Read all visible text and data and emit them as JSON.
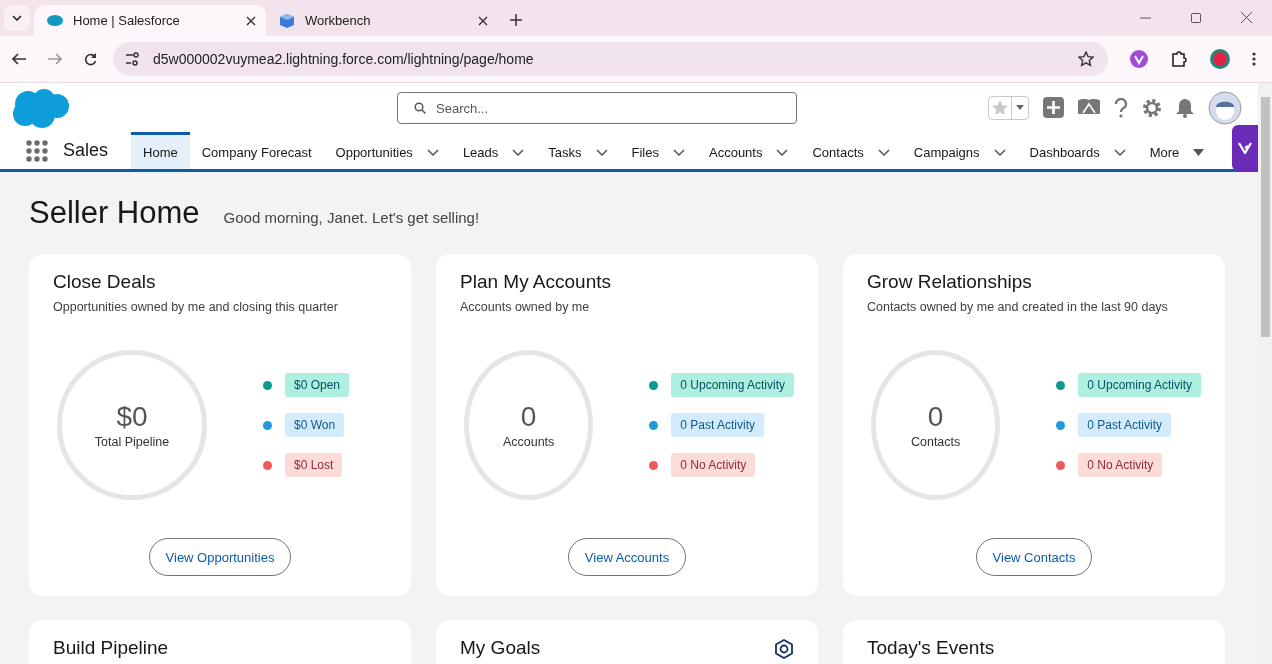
{
  "browser": {
    "tabs": [
      {
        "title": "Home | Salesforce",
        "selected": true
      },
      {
        "title": "Workbench",
        "selected": false
      }
    ],
    "url": "d5w000002vuymea2.lightning.force.com/lightning/page/home"
  },
  "header": {
    "search": {
      "placeholder": "Search..."
    }
  },
  "app": {
    "name": "Sales",
    "nav": [
      {
        "label": "Home",
        "selected": true,
        "kind": "plain"
      },
      {
        "label": "Company Forecast",
        "selected": false,
        "kind": "plain"
      },
      {
        "label": "Opportunities",
        "selected": false,
        "kind": "dropdown"
      },
      {
        "label": "Leads",
        "selected": false,
        "kind": "dropdown"
      },
      {
        "label": "Tasks",
        "selected": false,
        "kind": "dropdown"
      },
      {
        "label": "Files",
        "selected": false,
        "kind": "dropdown"
      },
      {
        "label": "Accounts",
        "selected": false,
        "kind": "dropdown"
      },
      {
        "label": "Contacts",
        "selected": false,
        "kind": "dropdown"
      },
      {
        "label": "Campaigns",
        "selected": false,
        "kind": "dropdown"
      },
      {
        "label": "Dashboards",
        "selected": false,
        "kind": "dropdown"
      },
      {
        "label": "More",
        "selected": false,
        "kind": "more"
      }
    ]
  },
  "page": {
    "title": "Seller Home",
    "greeting": "Good morning, Janet. Let's get selling!"
  },
  "cards": [
    {
      "title": "Close Deals",
      "subtitle": "Opportunities owned by me and closing this quarter",
      "value": "$0",
      "value_label": "Total Pipeline",
      "legend": [
        {
          "label": "$0 Open",
          "color": "#0c9a8c"
        },
        {
          "label": "$0 Won",
          "color": "#1f9ad6"
        },
        {
          "label": "$0 Lost",
          "color": "#ee5a5a"
        }
      ],
      "button": "View Opportunities"
    },
    {
      "title": "Plan My Accounts",
      "subtitle": "Accounts owned by me",
      "value": "0",
      "value_label": "Accounts",
      "legend": [
        {
          "label": "0 Upcoming Activity",
          "color": "#0c9a8c"
        },
        {
          "label": "0 Past Activity",
          "color": "#1f9ad6"
        },
        {
          "label": "0 No Activity",
          "color": "#ee5a5a"
        }
      ],
      "button": "View Accounts"
    },
    {
      "title": "Grow Relationships",
      "subtitle": "Contacts owned by me and created in the last 90 days",
      "value": "0",
      "value_label": "Contacts",
      "legend": [
        {
          "label": "0 Upcoming Activity",
          "color": "#0c9a8c"
        },
        {
          "label": "0 Past Activity",
          "color": "#1f9ad6"
        },
        {
          "label": "0 No Activity",
          "color": "#ee5a5a"
        }
      ],
      "button": "View Contacts"
    }
  ],
  "lower_cards": [
    {
      "title": "Build Pipeline",
      "settings": false
    },
    {
      "title": "My Goals",
      "settings": true
    },
    {
      "title": "Today's Events",
      "settings": false
    }
  ]
}
